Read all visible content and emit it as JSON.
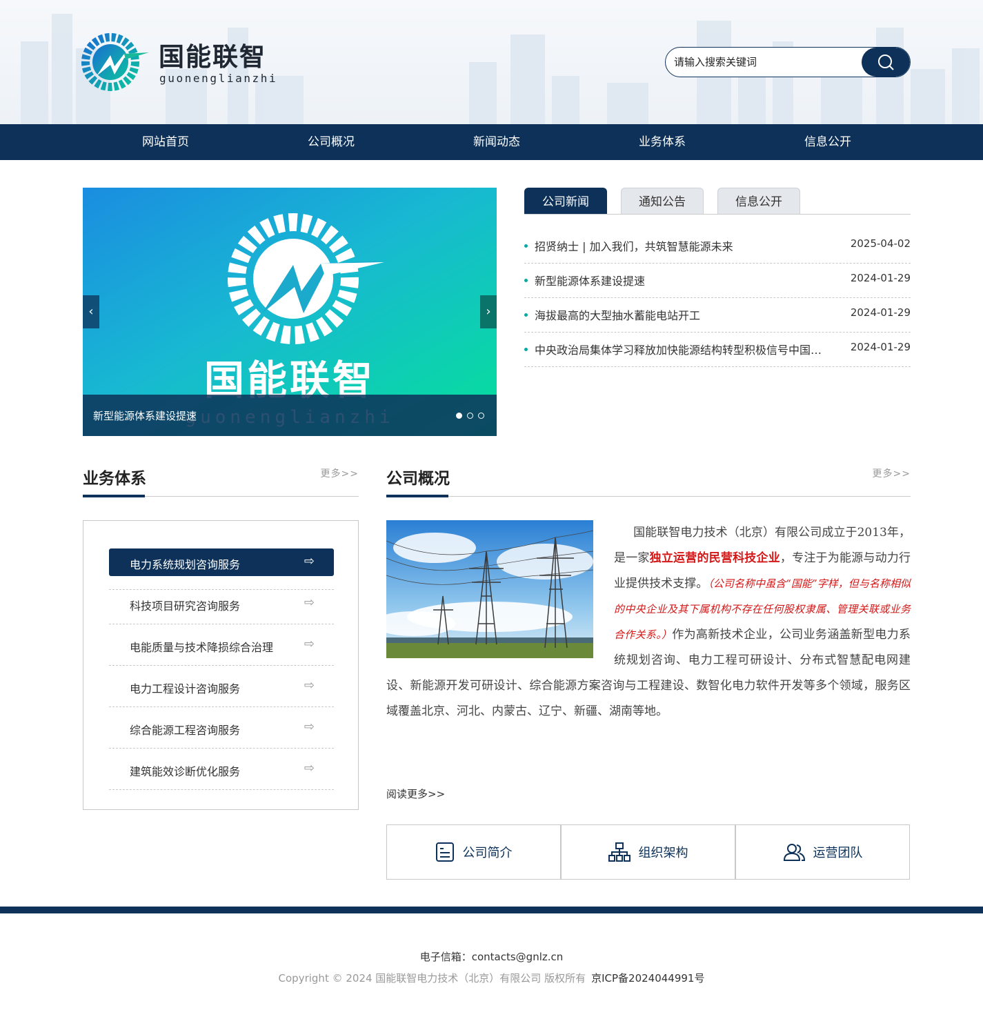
{
  "header": {
    "logo_cn": "国能联智",
    "logo_en": "guonenglianzhi",
    "search_placeholder": "请输入搜索关键词"
  },
  "nav": [
    "网站首页",
    "公司概况",
    "新闻动态",
    "业务体系",
    "信息公开"
  ],
  "banner": {
    "logo_cn": "国能联智",
    "logo_en": "guonenglianzhi",
    "caption": "新型能源体系建设提速",
    "prev": "‹",
    "next": "›"
  },
  "news": {
    "tabs": [
      "公司新闻",
      "通知公告",
      "信息公开"
    ],
    "items": [
      {
        "title": "招贤纳士 | 加入我们，共筑智慧能源未来",
        "date": "2025-04-02"
      },
      {
        "title": "新型能源体系建设提速",
        "date": "2024-01-29"
      },
      {
        "title": "海拔最高的大型抽水蓄能电站开工",
        "date": "2024-01-29"
      },
      {
        "title": "中央政治局集体学习释放加快能源结构转型积极信号中国能源报",
        "date": "2024-01-29"
      }
    ]
  },
  "business": {
    "title": "业务体系",
    "more": "更多>>",
    "items": [
      "电力系统规划咨询服务",
      "科技项目研究咨询服务",
      "电能质量与技术降损综合治理",
      "电力工程设计咨询服务",
      "综合能源工程咨询服务",
      "建筑能效诊断优化服务"
    ]
  },
  "about": {
    "title": "公司概况",
    "more": "更多>>",
    "p1": "国能联智电力技术（北京）有限公司成立于2013年，是一家",
    "p_strong": "独立运营的民营科技企业",
    "p2": "，专注于为能源与动力行业提供技术支撑。",
    "p_note": "（公司名称中虽含“国能”字样，但与名称相似的中央企业及其下属机构不存在任何股权隶属、管理关联或业务合作关系。）",
    "p3": "作为高新技术企业，公司业务涵盖新型电力系统规划咨询、电力工程可研设计、分布式智慧配电网建设、新能源开发可研设计、综合能源方案咨询与工程建设、数智化电力软件开发等多个领域，服务区域覆盖北京、河北、内蒙古、辽宁、新疆、湖南等地。",
    "read_more": "阅读更多>>"
  },
  "quick_links": [
    {
      "label": "公司简介",
      "icon": "document-icon"
    },
    {
      "label": "组织架构",
      "icon": "org-chart-icon"
    },
    {
      "label": "运营团队",
      "icon": "team-icon"
    }
  ],
  "footer": {
    "email": "电子信箱：contacts@gnlz.cn",
    "copyright": "Copyright © 2024 国能联智电力技术（北京）有限公司 版权所有",
    "icp": "京ICP备2024044991号"
  },
  "colors": {
    "primary": "#0d3158",
    "accent": "#0aa8a0",
    "red": "#d41818"
  }
}
